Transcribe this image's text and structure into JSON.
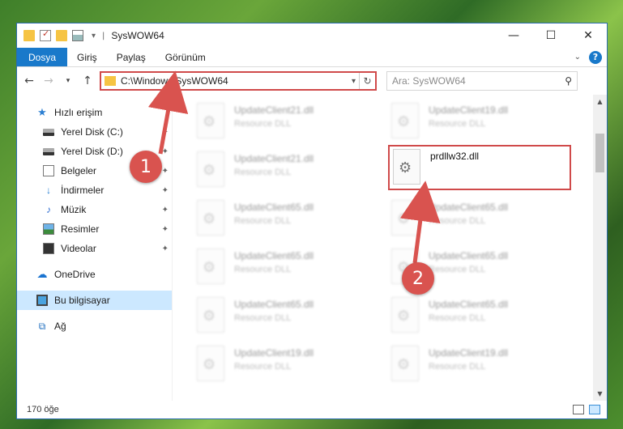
{
  "window": {
    "title": "SysWOW64",
    "controls": {
      "minimize": "—",
      "maximize": "☐",
      "close": "✕"
    }
  },
  "ribbon": {
    "tabs": [
      "Dosya",
      "Giriş",
      "Paylaş",
      "Görünüm"
    ],
    "help": "?"
  },
  "nav": {
    "address": "C:\\Windows\\SysWOW64",
    "search_placeholder": "Ara: SysWOW64"
  },
  "sidebar": {
    "items": [
      {
        "label": "Hızlı erişim",
        "icon": "star-icon"
      },
      {
        "label": "Yerel Disk (C:)",
        "icon": "drive-icon",
        "pinned": true
      },
      {
        "label": "Yerel Disk (D:)",
        "icon": "drive-icon",
        "pinned": true
      },
      {
        "label": "Belgeler",
        "icon": "documents-icon",
        "pinned": true
      },
      {
        "label": "İndirmeler",
        "icon": "downloads-icon",
        "pinned": true
      },
      {
        "label": "Müzik",
        "icon": "music-icon",
        "pinned": true
      },
      {
        "label": "Resimler",
        "icon": "pictures-icon",
        "pinned": true
      },
      {
        "label": "Videolar",
        "icon": "videos-icon",
        "pinned": true
      },
      {
        "label": "OneDrive",
        "icon": "cloud-icon"
      },
      {
        "label": "Bu bilgisayar",
        "icon": "computer-icon",
        "selected": true
      },
      {
        "label": "Ağ",
        "icon": "network-icon"
      }
    ]
  },
  "files": [
    {
      "name": "UpdateClient21.dll",
      "type": "Resource DLL"
    },
    {
      "name": "UpdateClient19.dll",
      "type": "Resource DLL"
    },
    {
      "name": "UpdateClient21.dll",
      "type": "Resource DLL"
    },
    {
      "name": "prdllw32.dll",
      "type": "",
      "highlighted": true
    },
    {
      "name": "UpdateClient65.dll",
      "type": "Resource DLL"
    },
    {
      "name": "UpdateClient65.dll",
      "type": "Resource DLL"
    },
    {
      "name": "UpdateClient65.dll",
      "type": "Resource DLL"
    },
    {
      "name": "UpdateClient65.dll",
      "type": "Resource DLL"
    },
    {
      "name": "UpdateClient65.dll",
      "type": "Resource DLL"
    },
    {
      "name": "UpdateClient65.dll",
      "type": "Resource DLL"
    },
    {
      "name": "UpdateClient19.dll",
      "type": "Resource DLL"
    },
    {
      "name": "UpdateClient19.dll",
      "type": "Resource DLL"
    }
  ],
  "status": {
    "count": "170 öğe"
  },
  "callouts": [
    "1",
    "2"
  ],
  "colors": {
    "accent": "#1979ca",
    "highlight": "#d04a4a",
    "selected": "#cce8ff"
  }
}
